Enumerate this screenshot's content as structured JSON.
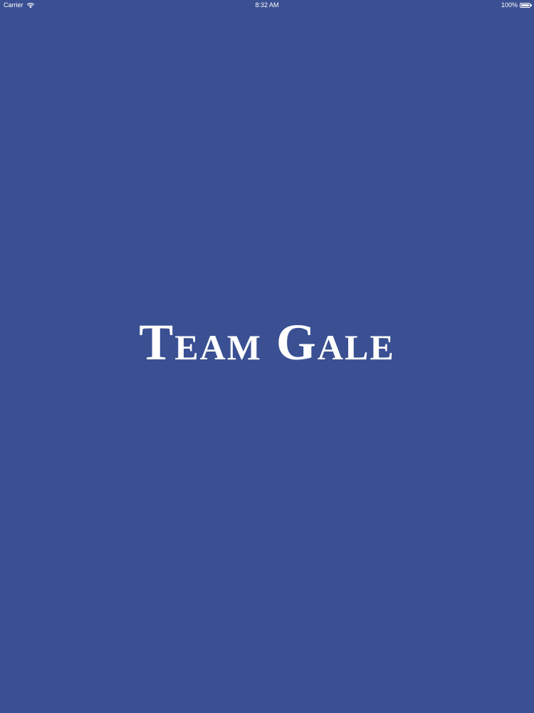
{
  "status_bar": {
    "carrier": "Carrier",
    "time": "8:32 AM",
    "battery_percent": "100%",
    "battery_level": 1.0,
    "icons": [
      "wifi-icon",
      "battery-icon"
    ]
  },
  "splash": {
    "title": "Team Gale",
    "background_color": "#3a5093",
    "text_color": "#ffffff"
  }
}
